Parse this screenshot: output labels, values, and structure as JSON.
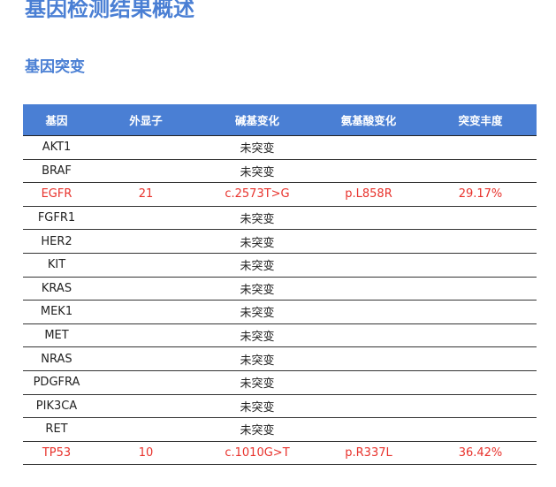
{
  "page": {
    "title": "基因检测结果概述",
    "section_title": "基因突变"
  },
  "colors": {
    "accent": "#4a7fd4",
    "mutation_highlight": "#e8322c"
  },
  "table": {
    "headers": [
      "基因",
      "外显子",
      "碱基变化",
      "氨基酸变化",
      "突变丰度"
    ],
    "rows": [
      {
        "gene": "AKT1",
        "exon": "",
        "base_change": "未突变",
        "aa_change": "",
        "abundance": "",
        "mutated": false
      },
      {
        "gene": "BRAF",
        "exon": "",
        "base_change": "未突变",
        "aa_change": "",
        "abundance": "",
        "mutated": false
      },
      {
        "gene": "EGFR",
        "exon": "21",
        "base_change": "c.2573T>G",
        "aa_change": "p.L858R",
        "abundance": "29.17%",
        "mutated": true
      },
      {
        "gene": "FGFR1",
        "exon": "",
        "base_change": "未突变",
        "aa_change": "",
        "abundance": "",
        "mutated": false
      },
      {
        "gene": "HER2",
        "exon": "",
        "base_change": "未突变",
        "aa_change": "",
        "abundance": "",
        "mutated": false
      },
      {
        "gene": "KIT",
        "exon": "",
        "base_change": "未突变",
        "aa_change": "",
        "abundance": "",
        "mutated": false
      },
      {
        "gene": "KRAS",
        "exon": "",
        "base_change": "未突变",
        "aa_change": "",
        "abundance": "",
        "mutated": false
      },
      {
        "gene": "MEK1",
        "exon": "",
        "base_change": "未突变",
        "aa_change": "",
        "abundance": "",
        "mutated": false
      },
      {
        "gene": "MET",
        "exon": "",
        "base_change": "未突变",
        "aa_change": "",
        "abundance": "",
        "mutated": false
      },
      {
        "gene": "NRAS",
        "exon": "",
        "base_change": "未突变",
        "aa_change": "",
        "abundance": "",
        "mutated": false
      },
      {
        "gene": "PDGFRA",
        "exon": "",
        "base_change": "未突变",
        "aa_change": "",
        "abundance": "",
        "mutated": false
      },
      {
        "gene": "PIK3CA",
        "exon": "",
        "base_change": "未突变",
        "aa_change": "",
        "abundance": "",
        "mutated": false
      },
      {
        "gene": "RET",
        "exon": "",
        "base_change": "未突变",
        "aa_change": "",
        "abundance": "",
        "mutated": false
      },
      {
        "gene": "TP53",
        "exon": "10",
        "base_change": "c.1010G>T",
        "aa_change": "p.R337L",
        "abundance": "36.42%",
        "mutated": true
      }
    ]
  }
}
